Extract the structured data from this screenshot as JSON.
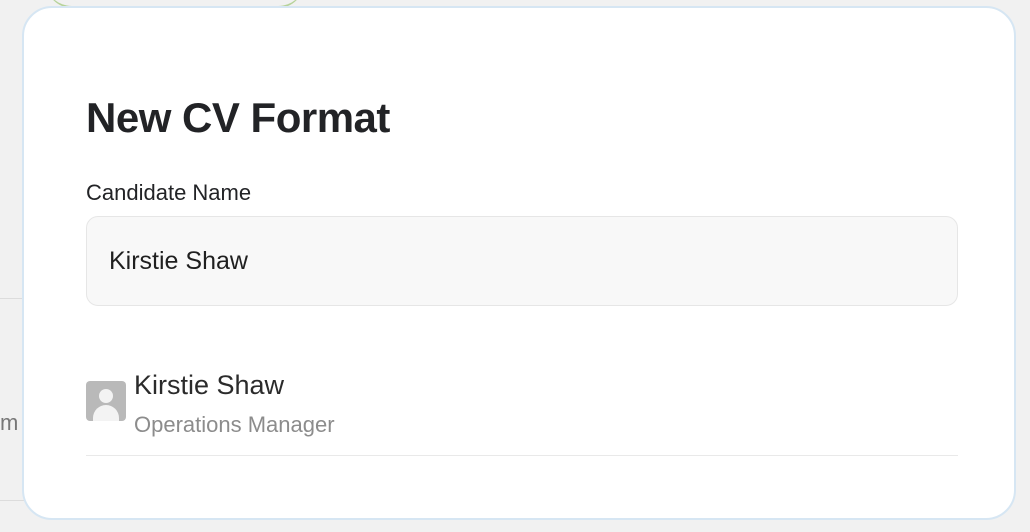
{
  "background": {
    "partial_text": "m"
  },
  "modal": {
    "title": "New CV Format",
    "candidate_field": {
      "label": "Candidate Name",
      "value": "Kirstie Shaw",
      "placeholder": ""
    },
    "suggestions": [
      {
        "name": "Kirstie Shaw",
        "role": "Operations Manager",
        "avatar_icon": "user-placeholder-icon"
      }
    ]
  },
  "colors": {
    "modal_border": "#d6e6f3",
    "input_background": "#f8f8f8",
    "title_text": "#222326",
    "secondary_text": "#8c8c8c"
  }
}
